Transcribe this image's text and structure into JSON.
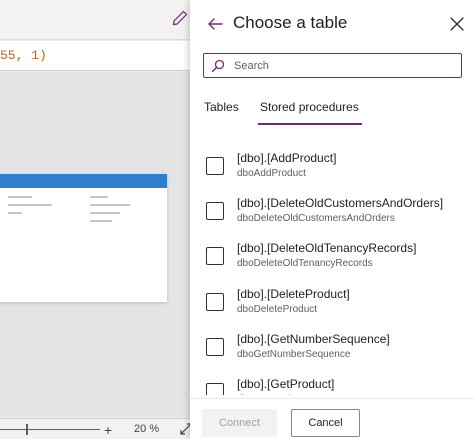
{
  "background": {
    "formula_text": "55, 1)",
    "zoom_value": "20",
    "zoom_unit": "%",
    "zoom_plus": "+"
  },
  "panel": {
    "title": "Choose a table",
    "search": {
      "placeholder": "Search",
      "value": ""
    },
    "tabs": [
      {
        "label": "Tables",
        "selected": false
      },
      {
        "label": "Stored procedures",
        "selected": true
      }
    ],
    "items": [
      {
        "name": "[dbo].[AddProduct]",
        "sub": "dboAddProduct",
        "checked": false
      },
      {
        "name": "[dbo].[DeleteOldCustomersAndOrders]",
        "sub": "dboDeleteOldCustomersAndOrders",
        "checked": false
      },
      {
        "name": "[dbo].[DeleteOldTenancyRecords]",
        "sub": "dboDeleteOldTenancyRecords",
        "checked": false
      },
      {
        "name": "[dbo].[DeleteProduct]",
        "sub": "dboDeleteProduct",
        "checked": false
      },
      {
        "name": "[dbo].[GetNumberSequence]",
        "sub": "dboGetNumberSequence",
        "checked": false
      },
      {
        "name": "[dbo].[GetProduct]",
        "sub": "dboGetProduct",
        "checked": false
      }
    ],
    "buttons": {
      "connect": "Connect",
      "cancel": "Cancel"
    }
  },
  "colors": {
    "accent": "#742774",
    "panel_bg": "#ffffff",
    "disabled_button_bg": "#f3f2f1"
  }
}
